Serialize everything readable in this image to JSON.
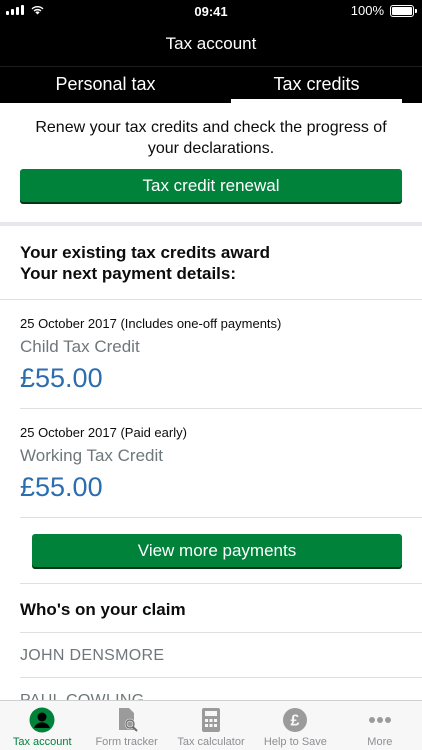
{
  "status": {
    "time": "09:41",
    "battery": "100%"
  },
  "nav": {
    "title": "Tax account"
  },
  "tabs": [
    {
      "label": "Personal tax",
      "active": false
    },
    {
      "label": "Tax credits",
      "active": true
    }
  ],
  "renew": {
    "text": "Renew your tax credits and check the progress of your declarations.",
    "button_label": "Tax credit renewal"
  },
  "award": {
    "line1": "Your existing tax credits award",
    "line2": "Your next payment details:"
  },
  "payments": [
    {
      "date": "25 October 2017 (Includes one-off payments)",
      "type": "Child Tax Credit",
      "amount": "£55.00"
    },
    {
      "date": "25 October 2017 (Paid early)",
      "type": "Working Tax Credit",
      "amount": "£55.00"
    }
  ],
  "more_payments_label": "View more payments",
  "claim": {
    "heading": "Who's on your claim",
    "people": [
      "JOHN DENSMORE",
      "PAUL COWLING"
    ]
  },
  "tabbar": [
    {
      "label": "Tax account",
      "icon": "person-icon",
      "active": true
    },
    {
      "label": "Form tracker",
      "icon": "form-search-icon",
      "active": false
    },
    {
      "label": "Tax calculator",
      "icon": "calculator-icon",
      "active": false
    },
    {
      "label": "Help to Save",
      "icon": "pound-coin-icon",
      "active": false
    },
    {
      "label": "More",
      "icon": "more-dots-icon",
      "active": false
    }
  ],
  "colors": {
    "primary_green": "#00823b",
    "amount_blue": "#2b6eb0",
    "muted_grey": "#6f777b"
  }
}
